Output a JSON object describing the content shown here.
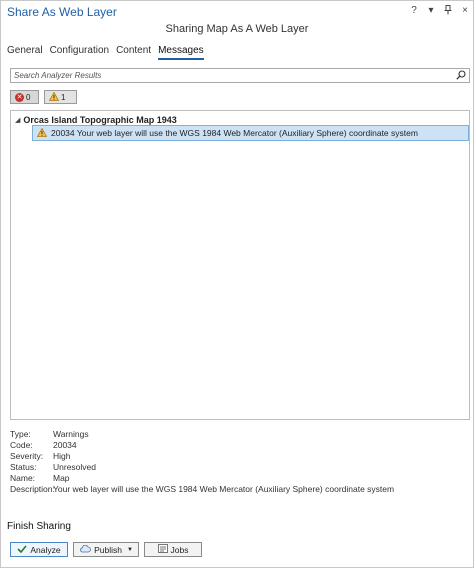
{
  "window": {
    "title": "Share As Web Layer",
    "subtitle": "Sharing Map As A Web Layer",
    "help_icon": "?",
    "menu_icon": "▾",
    "pin_icon": "pin-icon",
    "close_icon": "×"
  },
  "tabs": [
    {
      "label": "General"
    },
    {
      "label": "Configuration"
    },
    {
      "label": "Content"
    },
    {
      "label": "Messages"
    }
  ],
  "search": {
    "placeholder": "Search Analyzer Results"
  },
  "filters": {
    "errors_count": "0",
    "warnings_count": "1"
  },
  "results": {
    "group_title": "Orcas Island Topographic Map 1943",
    "message": "20034 Your web layer will use the WGS 1984 Web Mercator (Auxiliary Sphere) coordinate system"
  },
  "details": {
    "type_label": "Type:",
    "type_value": "Warnings",
    "code_label": "Code:",
    "code_value": "20034",
    "severity_label": "Severity:",
    "severity_value": "High",
    "status_label": "Status:",
    "status_value": "Unresolved",
    "name_label": "Name:",
    "name_value": "Map",
    "description_label": "Description:",
    "description_value": "Your web layer will use the WGS 1984 Web Mercator (Auxiliary Sphere) coordinate system"
  },
  "finish": {
    "heading": "Finish Sharing",
    "analyze_label": "Analyze",
    "publish_label": "Publish",
    "jobs_label": "Jobs"
  },
  "colors": {
    "accent": "#1f5fa8",
    "selection": "#cde3f5",
    "error": "#c5322e",
    "warning": "#e8a317"
  }
}
